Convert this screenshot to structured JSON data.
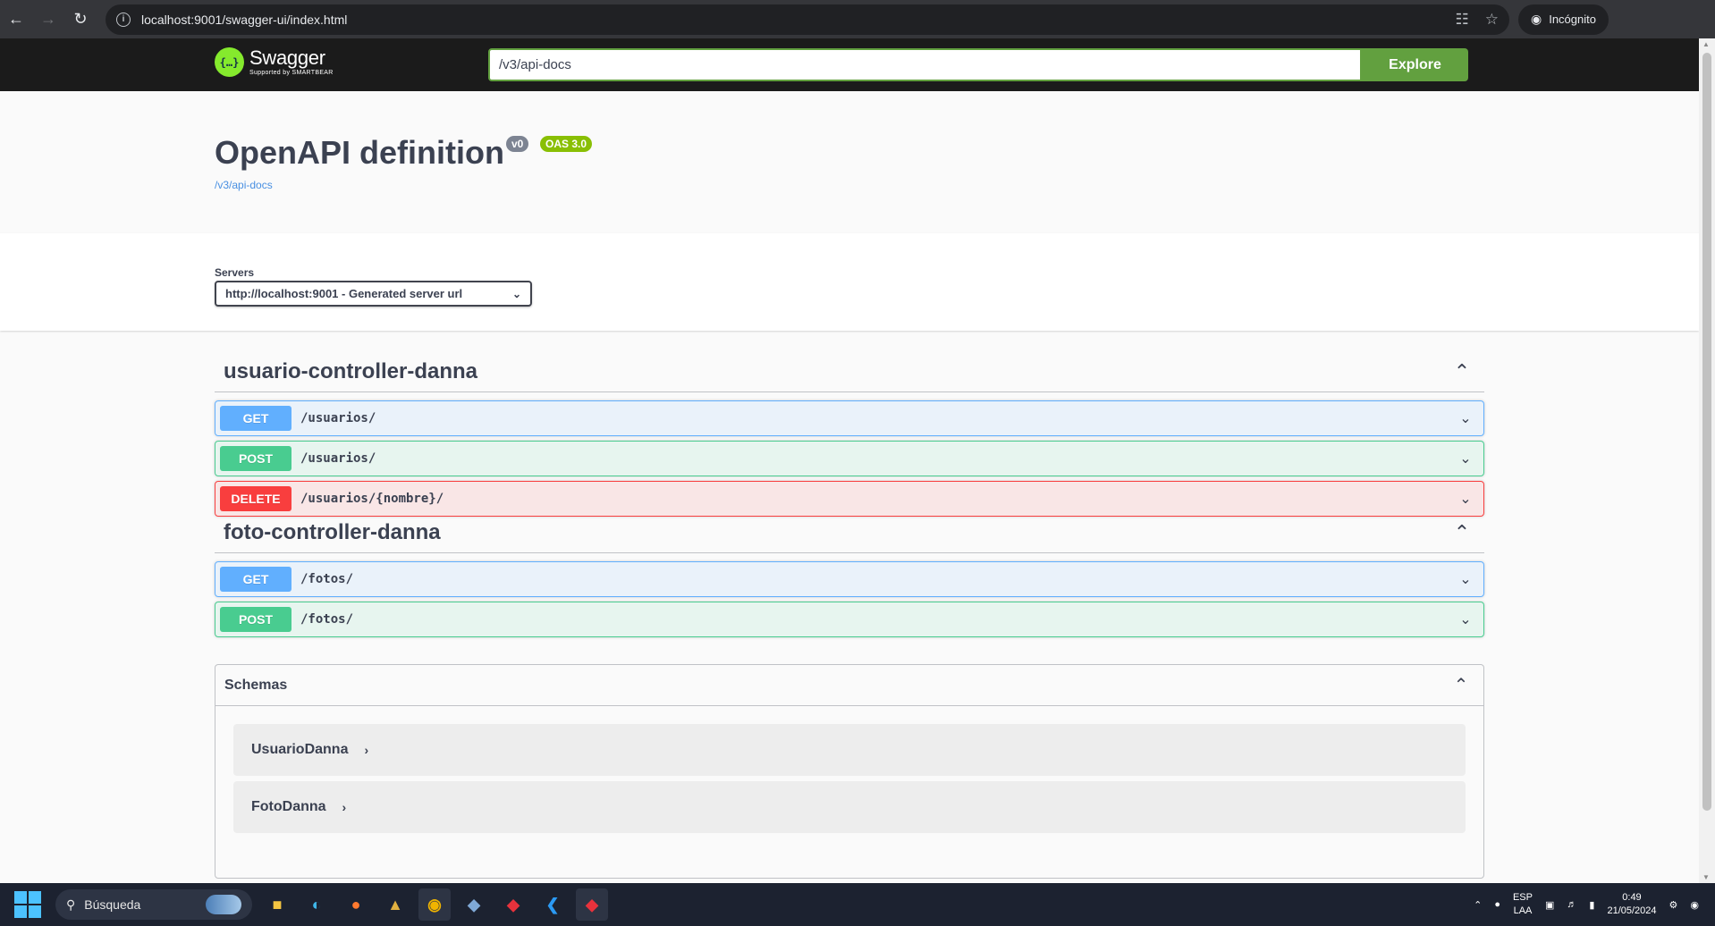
{
  "browser": {
    "url": "localhost:9001/swagger-ui/index.html",
    "profile_label": "Incógnito"
  },
  "swagger": {
    "logo_text": "Swagger",
    "logo_subtext": "Supported by SMARTBEAR",
    "explore_value": "/v3/api-docs",
    "explore_label": "Explore"
  },
  "info": {
    "title": "OpenAPI definition",
    "version_badge": "v0",
    "oas_badge": "OAS 3.0",
    "spec_link": "/v3/api-docs"
  },
  "servers": {
    "label": "Servers",
    "selected": "http://localhost:9001 - Generated server url"
  },
  "tags": [
    {
      "name": "usuario-controller-danna",
      "operations": [
        {
          "method": "GET",
          "path": "/usuarios/"
        },
        {
          "method": "POST",
          "path": "/usuarios/"
        },
        {
          "method": "DELETE",
          "path": "/usuarios/{nombre}/"
        }
      ]
    },
    {
      "name": "foto-controller-danna",
      "operations": [
        {
          "method": "GET",
          "path": "/fotos/"
        },
        {
          "method": "POST",
          "path": "/fotos/"
        }
      ]
    }
  ],
  "schemas": {
    "title": "Schemas",
    "models": [
      "UsuarioDanna",
      "FotoDanna"
    ]
  },
  "taskbar": {
    "search_placeholder": "Búsqueda",
    "lang_top": "ESP",
    "lang_bottom": "LAA",
    "time": "0:49",
    "date": "21/05/2024"
  },
  "colors": {
    "get": "#61affe",
    "post": "#49cc90",
    "delete": "#f93e3e",
    "explore": "#62a03f",
    "oas_badge": "#89bf04"
  }
}
